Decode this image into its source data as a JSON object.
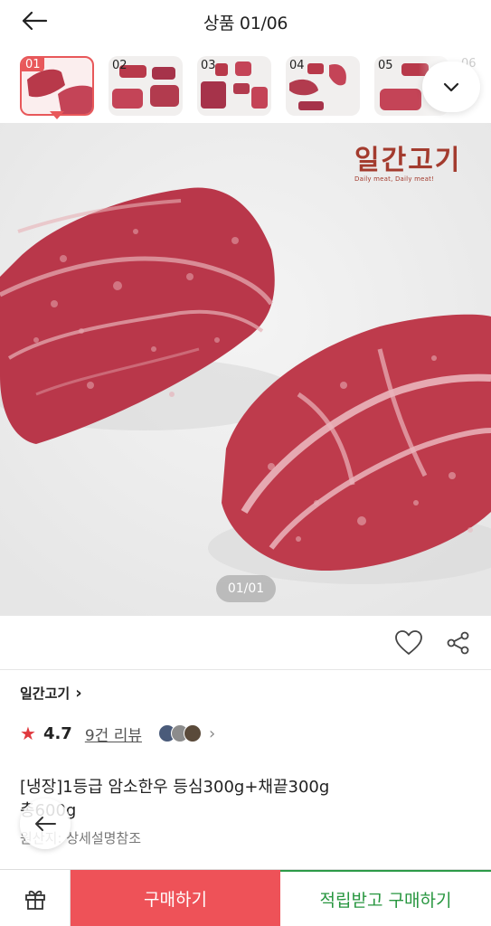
{
  "header": {
    "title": "상품 01/06"
  },
  "thumbnails": [
    {
      "num": "01",
      "active": true
    },
    {
      "num": "02",
      "active": false
    },
    {
      "num": "03",
      "active": false
    },
    {
      "num": "04",
      "active": false
    },
    {
      "num": "05",
      "active": false
    }
  ],
  "thumb_partial_num": "06",
  "main_image": {
    "logo_text": "일간고기",
    "logo_sub": "Daily meat, Daily meat!",
    "page_indicator": "01/01"
  },
  "seller": {
    "name": "일간고기",
    "chevron": "›"
  },
  "rating": {
    "star": "★",
    "value": "4.7",
    "reviews_label": "9건 리뷰",
    "chevron": "›"
  },
  "product": {
    "name_line1": "[냉장]1등급 암소한우 등심300g+채끝300g",
    "name_line2": "총600g",
    "origin": "원산지: 상세설명참조"
  },
  "bottom_bar": {
    "buy_label": "구매하기",
    "points_buy_label": "적립받고 구매하기"
  },
  "colors": {
    "accent_red": "#ee5258",
    "accent_green": "#27963f",
    "brand": "#a33b2e"
  },
  "icons": {
    "back": "arrow-left-icon",
    "expand": "chevron-down-icon",
    "heart": "heart-icon",
    "share": "share-icon",
    "gift": "gift-icon"
  }
}
